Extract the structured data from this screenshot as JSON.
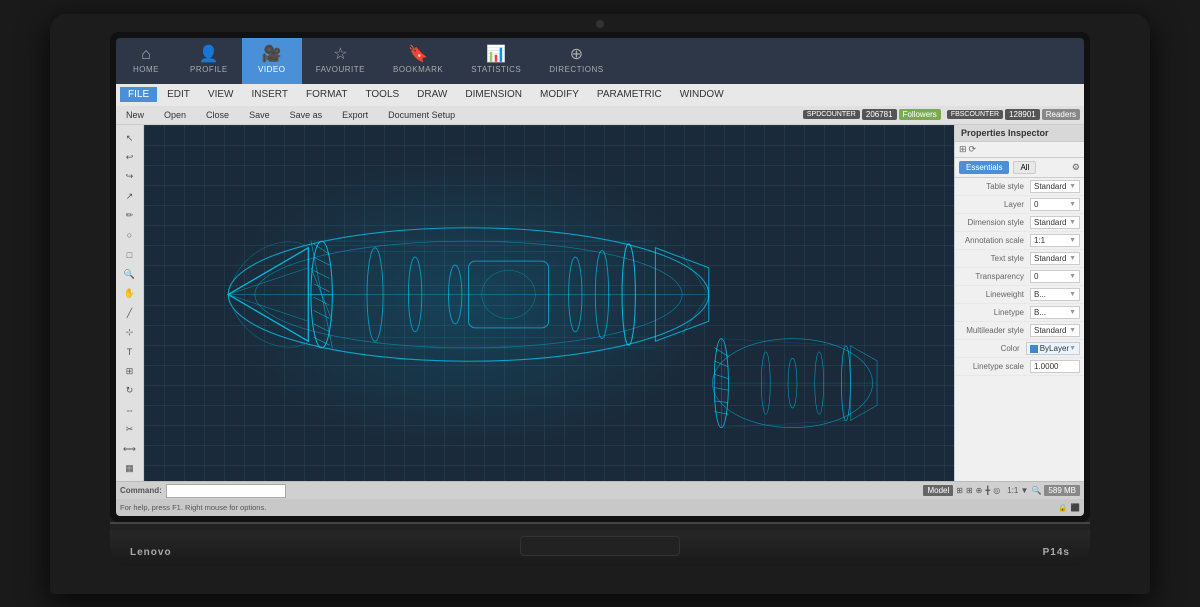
{
  "laptop": {
    "brand": "Lenovo",
    "model": "P14s"
  },
  "topnav": {
    "items": [
      {
        "id": "home",
        "label": "HOME",
        "icon": "⌂",
        "active": false
      },
      {
        "id": "profile",
        "label": "PROFILE",
        "icon": "👤",
        "active": false
      },
      {
        "id": "video",
        "label": "VIDEO",
        "icon": "🎥",
        "active": true
      },
      {
        "id": "favourite",
        "label": "FAVOURITE",
        "icon": "☆",
        "active": false
      },
      {
        "id": "bookmark",
        "label": "BOOKMARK",
        "icon": "🔖",
        "active": false
      },
      {
        "id": "statistics",
        "label": "STATISTICS",
        "icon": "📊",
        "active": false
      },
      {
        "id": "directions",
        "label": "DIRECTIONS",
        "icon": "⊕",
        "active": false
      }
    ]
  },
  "menubar": {
    "items": [
      "FILE",
      "EDIT",
      "VIEW",
      "INSERT",
      "FORMAT",
      "TOOLS",
      "DRAW",
      "DIMENSION",
      "MODIFY",
      "PARAMETRIC",
      "WINDOW"
    ]
  },
  "toolbar": {
    "buttons": [
      "New",
      "Open",
      "Close",
      "Save",
      "Save as",
      "Export",
      "Document Setup"
    ],
    "counter1_label": "SPDCOUNTER",
    "counter1_value": "206781",
    "counter1_badge": "Followers",
    "counter2_label": "FBSCOUNTER",
    "counter2_value": "128901",
    "counter2_badge": "Readers"
  },
  "properties": {
    "title": "Properties Inspector",
    "tab1": "Essentials",
    "tab2": "All",
    "rows": [
      {
        "label": "Table style",
        "value": "Standard"
      },
      {
        "label": "Layer",
        "value": "0"
      },
      {
        "label": "Dimension style",
        "value": "Standard"
      },
      {
        "label": "Annotation scale",
        "value": "1:1"
      },
      {
        "label": "Text style",
        "value": "Standard"
      },
      {
        "label": "Transparency",
        "value": "0"
      },
      {
        "label": "Lineweight",
        "value": "B..."
      },
      {
        "label": "Linetype",
        "value": "B..."
      },
      {
        "label": "Multileader style",
        "value": "Standard"
      },
      {
        "label": "Color",
        "value": "ByLayer"
      },
      {
        "label": "Linetype scale",
        "value": "1.0000"
      }
    ]
  },
  "statusbar": {
    "help_text": "For help, press F1. Right mouse for options.",
    "model_label": "Model",
    "memory": "589 MB",
    "scale": "1:1"
  },
  "command": {
    "label": "Command:",
    "placeholder": ""
  }
}
